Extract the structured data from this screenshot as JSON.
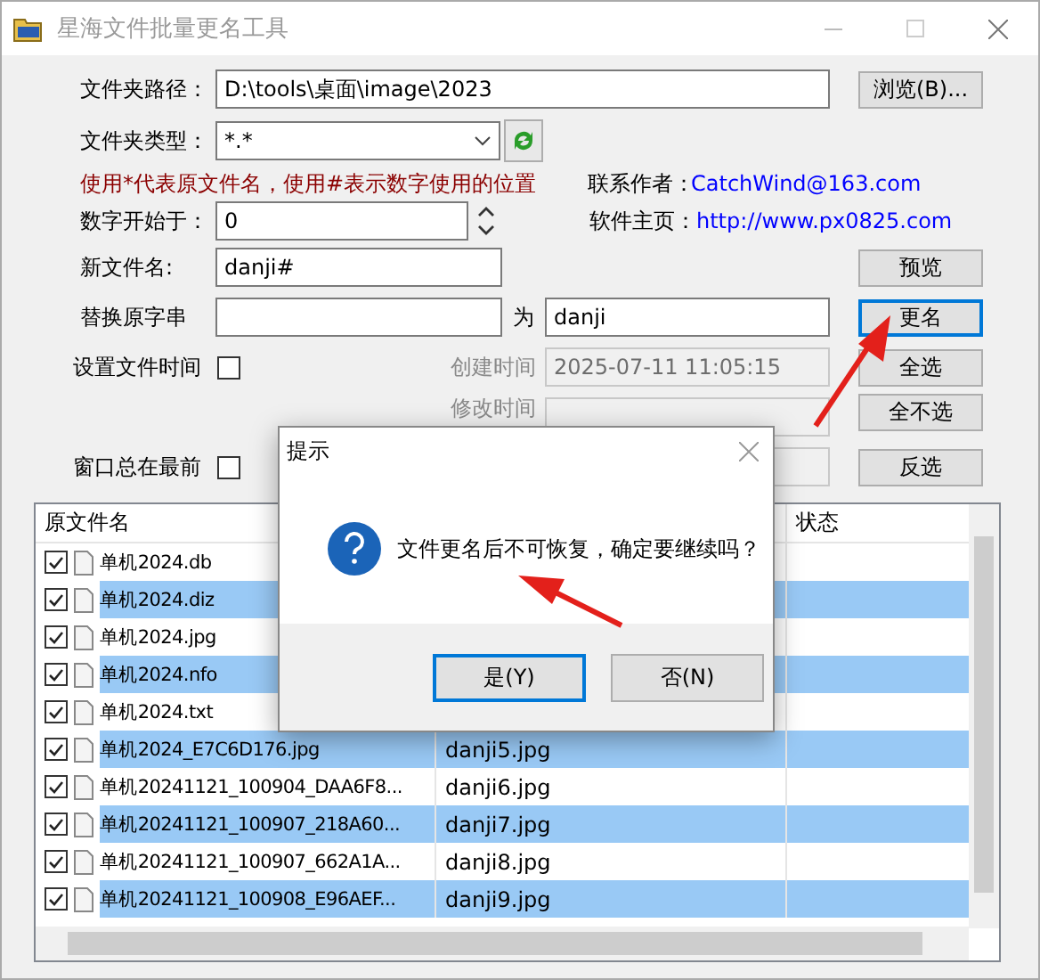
{
  "window": {
    "title": "星海文件批量更名工具"
  },
  "form": {
    "folder_path": {
      "label": "文件夹路径：",
      "value": "D:\\tools\\桌面\\image\\2023"
    },
    "browse_button": "浏览(B)...",
    "file_type": {
      "label": "文件夹类型：",
      "value": "*.*"
    },
    "hint": "使用*代表原文件名，使用#表示数字使用的位置",
    "start_number": {
      "label": "数字开始于：",
      "value": "0"
    },
    "contact": {
      "label": "联系作者：",
      "value": "CatchWind@163.com"
    },
    "homepage": {
      "label": "软件主页：",
      "value": "http://www.px0825.com"
    },
    "new_name": {
      "label": "新文件名:",
      "value": "danji#"
    },
    "replace": {
      "label": "替换原字串",
      "with_label": "为",
      "with_value": "danji"
    },
    "set_file_time": {
      "label": "设置文件时间",
      "checked": false
    },
    "created_time": {
      "label": "创建时间",
      "value": "2025-07-11 11:05:15",
      "disabled": true
    },
    "modified_time": {
      "label": "修改时间",
      "disabled": true
    },
    "always_on_top": {
      "label": "窗口总在最前",
      "checked": false
    }
  },
  "buttons": [
    {
      "label": "预览",
      "focused": false
    },
    {
      "label": "更名",
      "focused": true
    },
    {
      "label": "全选",
      "focused": false
    },
    {
      "label": "全不选",
      "focused": false
    },
    {
      "label": "反选",
      "focused": false
    }
  ],
  "file_list": {
    "column_1": "原文件名",
    "column_3": "状态",
    "rows": [
      {
        "name": "单机2024.db",
        "checked": true,
        "selected": false
      },
      {
        "name": "单机2024.diz",
        "checked": true,
        "selected": true
      },
      {
        "name": "单机2024.jpg",
        "checked": true,
        "selected": false
      },
      {
        "name": "单机2024.nfo",
        "checked": true,
        "selected": true
      },
      {
        "name": "单机2024.txt",
        "checked": true,
        "selected": false
      },
      {
        "name": "单机2024_E7C6D176.jpg",
        "new_name": "danji5.jpg",
        "checked": true,
        "selected": true
      },
      {
        "name": "单机20241121_100904_DAA6F8...",
        "new_name": "danji6.jpg",
        "checked": true,
        "selected": false
      },
      {
        "name": "单机20241121_100907_218A60...",
        "new_name": "danji7.jpg",
        "checked": true,
        "selected": true
      },
      {
        "name": "单机20241121_100907_662A1A...",
        "new_name": "danji8.jpg",
        "checked": true,
        "selected": false
      },
      {
        "name": "单机20241121_100908_E96AEF...",
        "new_name": "danji9.jpg",
        "checked": true,
        "selected": true
      }
    ]
  },
  "dialog": {
    "title": "提示",
    "message": "文件更名后不可恢复，确定要继续吗？",
    "buttons": [
      {
        "label": "是(Y)",
        "default": true
      },
      {
        "label": "否(N)",
        "default": false
      }
    ]
  }
}
